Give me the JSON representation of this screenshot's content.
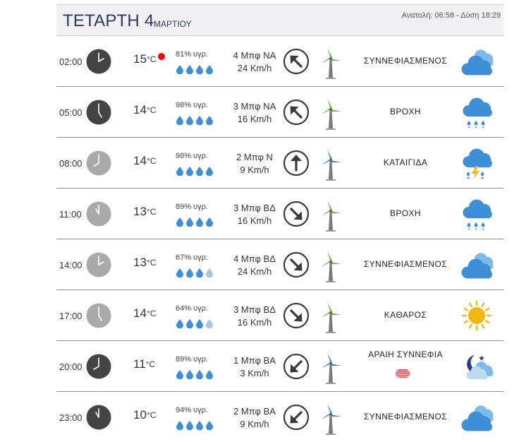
{
  "header": {
    "day": "ΤΕΤΑΡΤΗ 4",
    "month": "ΜΑΡΤΙΟΥ",
    "sunrise_sunset": "Ανατολή: 06:58 - Δύση 18:29"
  },
  "colors": {
    "dark_clock": "#444444",
    "light_clock": "#aaaaaa",
    "drop_full": "#3d8fd8",
    "drop_empty": "#a8c6e0",
    "turbine_green": "#6cb33e",
    "turbine_blue": "#3c86c2",
    "alert": "#ff0000"
  },
  "rows": [
    {
      "time": "02:00",
      "clock": "dark",
      "temp": "15",
      "unit": "°C",
      "alert": true,
      "humidity": "81% υγρ.",
      "drops_full": 4,
      "wind_bft": "4 Μπφ ΝΑ",
      "wind_kmh": "24 Km/h",
      "arrow_icon": "arrow-up-left-icon",
      "arrow_deg": -45,
      "turbine": "green",
      "condition": "ΣΥΝΝΕΦΙΑΣΜΕΝΟΣ",
      "icon": "cloudy-icon"
    },
    {
      "time": "05:00",
      "clock": "dark",
      "temp": "14",
      "unit": "°C",
      "alert": false,
      "humidity": "98% υγρ.",
      "drops_full": 4,
      "wind_bft": "3 Μπφ ΝΑ",
      "wind_kmh": "16 Km/h",
      "arrow_icon": "arrow-up-left-icon",
      "arrow_deg": -45,
      "turbine": "green",
      "condition": "ΒΡΟΧΗ",
      "icon": "rain-icon"
    },
    {
      "time": "08:00",
      "clock": "light",
      "temp": "14",
      "unit": "°C",
      "alert": false,
      "humidity": "98% υγρ.",
      "drops_full": 4,
      "wind_bft": "2 Μπφ Ν",
      "wind_kmh": "9 Km/h",
      "arrow_icon": "arrow-up-icon",
      "arrow_deg": 0,
      "turbine": "blue",
      "condition": "ΚΑΤΑΙΓΙΔΑ",
      "icon": "thunderstorm-icon"
    },
    {
      "time": "11:00",
      "clock": "light",
      "temp": "13",
      "unit": "°C",
      "alert": false,
      "humidity": "89% υγρ.",
      "drops_full": 4,
      "wind_bft": "3 Μπφ ΒΔ",
      "wind_kmh": "16 Km/h",
      "arrow_icon": "arrow-down-right-icon",
      "arrow_deg": 135,
      "turbine": "green",
      "condition": "ΒΡΟΧΗ",
      "icon": "rain-icon"
    },
    {
      "time": "14:00",
      "clock": "light",
      "temp": "13",
      "unit": "°C",
      "alert": false,
      "humidity": "67% υγρ.",
      "drops_full": 3,
      "wind_bft": "4 Μπφ ΒΔ",
      "wind_kmh": "24 Km/h",
      "arrow_icon": "arrow-down-right-icon",
      "arrow_deg": 135,
      "turbine": "green",
      "condition": "ΣΥΝΝΕΦΙΑΣΜΕΝΟΣ",
      "icon": "cloudy-icon"
    },
    {
      "time": "17:00",
      "clock": "light",
      "temp": "14",
      "unit": "°C",
      "alert": false,
      "humidity": "64% υγρ.",
      "drops_full": 3,
      "wind_bft": "3 Μπφ ΒΔ",
      "wind_kmh": "16 Km/h",
      "arrow_icon": "arrow-down-right-icon",
      "arrow_deg": 135,
      "turbine": "green",
      "condition": "ΚΑΘΑΡΟΣ",
      "icon": "sun-icon"
    },
    {
      "time": "20:00",
      "clock": "dark",
      "temp": "11",
      "unit": "°C",
      "alert": false,
      "humidity": "89% υγρ.",
      "drops_full": 4,
      "wind_bft": "1 Μπφ ΒΑ",
      "wind_kmh": "3 Km/h",
      "arrow_icon": "arrow-down-left-icon",
      "arrow_deg": -135,
      "turbine": "blue",
      "condition": "ΑΡΑΙΗ ΣΥΝΝΕΦΙΑ",
      "icon": "night-partly-cloudy-icon",
      "haze": true
    },
    {
      "time": "23:00",
      "clock": "dark",
      "temp": "10",
      "unit": "°C",
      "alert": false,
      "humidity": "94% υγρ.",
      "drops_full": 4,
      "wind_bft": "2 Μπφ ΒΑ",
      "wind_kmh": "9 Km/h",
      "arrow_icon": "arrow-down-left-icon",
      "arrow_deg": -135,
      "turbine": "blue",
      "condition": "ΣΥΝΝΕΦΙΑΣΜΕΝΟΣ",
      "icon": "cloudy-icon"
    }
  ]
}
